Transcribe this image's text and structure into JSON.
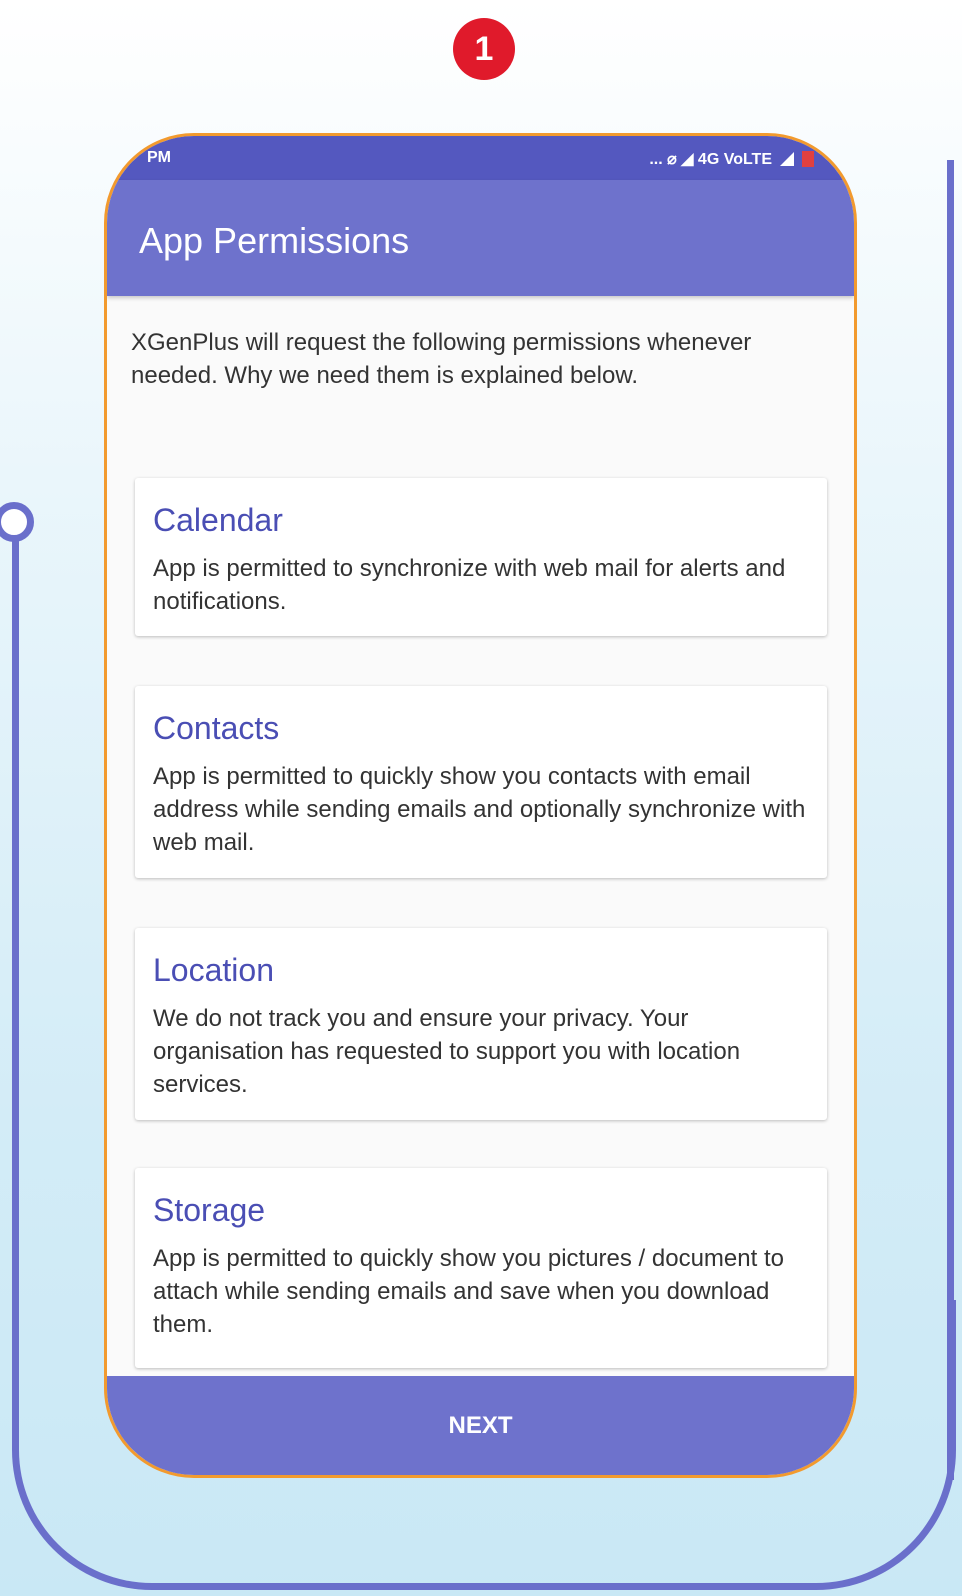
{
  "step": {
    "number": "1"
  },
  "status_bar": {
    "time": "PM",
    "network": "... ⌀ ◢ 4G VoLTE"
  },
  "app_bar": {
    "title": "App Permissions"
  },
  "intro_text": "XGenPlus will request the following permissions whenever needed. Why we need them is explained below.",
  "permissions": [
    {
      "title": "Calendar",
      "description": "App is permitted to synchronize with web mail for alerts and notifications."
    },
    {
      "title": "Contacts",
      "description": "App is permitted to quickly show you contacts with email address while sending emails and optionally synchronize with web mail."
    },
    {
      "title": "Location",
      "description": "We do not track you and ensure your privacy. Your organisation has requested to support you with location services."
    },
    {
      "title": "Storage",
      "description": "App is permitted to quickly show you pictures / document to attach while sending emails and save when you download them."
    }
  ],
  "next_button": {
    "label": "NEXT"
  },
  "colors": {
    "primary": "#6e72cc",
    "status_bar": "#5458bf",
    "accent_title": "#4a4eb4",
    "badge": "#e01a2b",
    "phone_border": "#f29a2e"
  }
}
